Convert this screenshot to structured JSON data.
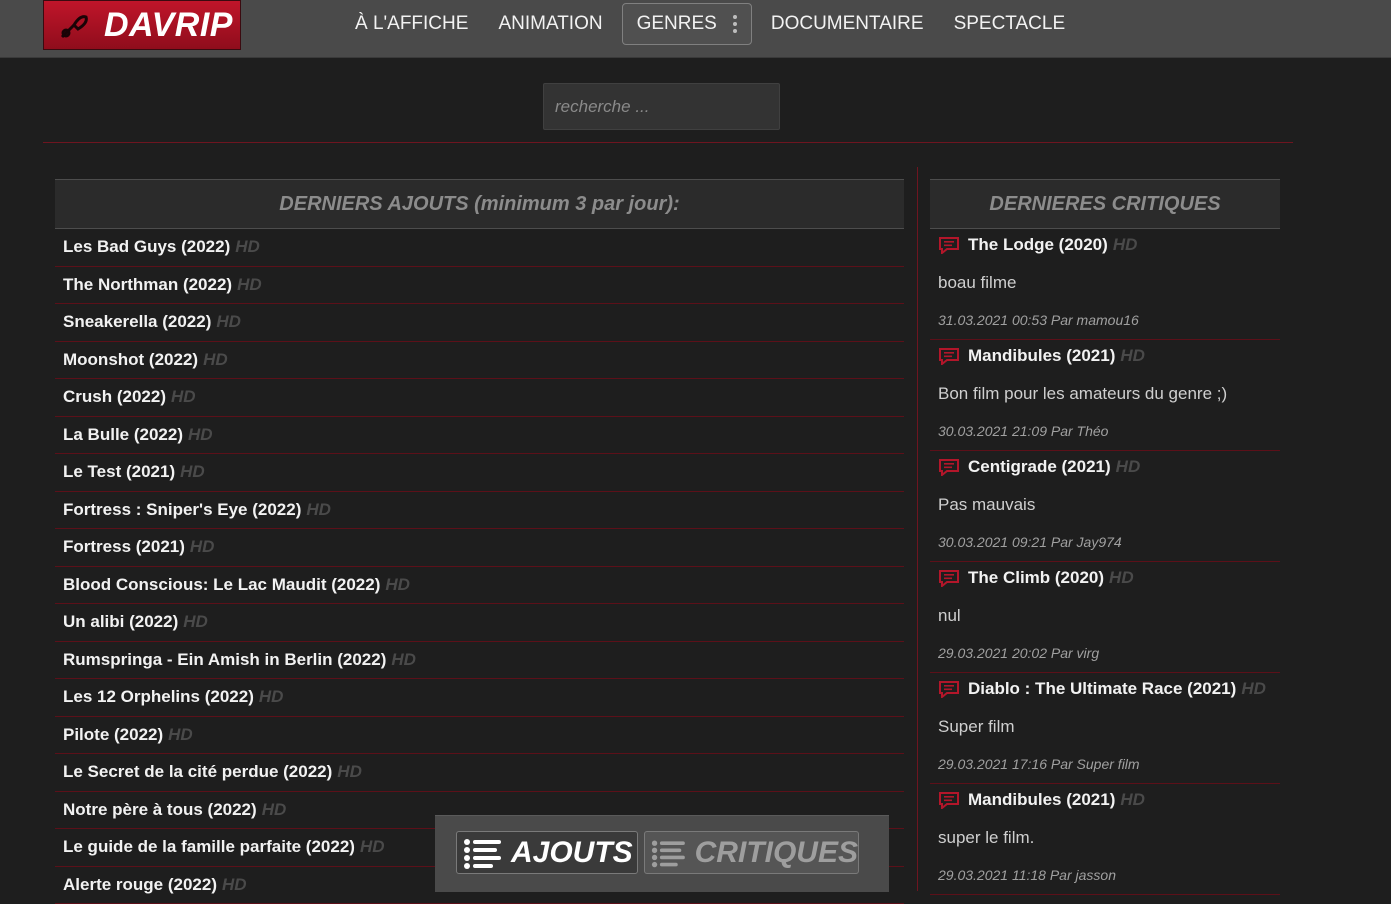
{
  "brand": {
    "name": "DAVRIP"
  },
  "nav": [
    {
      "label": "À L'AFFICHE"
    },
    {
      "label": "ANIMATION"
    },
    {
      "label": "GENRES"
    },
    {
      "label": "DOCUMENTAIRE"
    },
    {
      "label": "SPECTACLE"
    }
  ],
  "search": {
    "placeholder": "recherche ..."
  },
  "latest": {
    "title": "DERNIERS AJOUTS (minimum 3 par jour):",
    "quality": "HD",
    "items": [
      "Les Bad Guys (2022)",
      "The Northman (2022)",
      "Sneakerella (2022)",
      "Moonshot (2022)",
      "Crush (2022)",
      "La Bulle (2022)",
      "Le Test (2021)",
      "Fortress : Sniper's Eye (2022)",
      "Fortress (2021)",
      "Blood Conscious: Le Lac Maudit (2022)",
      "Un alibi (2022)",
      "Rumspringa - Ein Amish in Berlin (2022)",
      "Les 12 Orphelins (2022)",
      "Pilote (2022)",
      "Le Secret de la cité perdue (2022)",
      "Notre père à tous (2022)",
      "Le guide de la famille parfaite (2022)",
      "Alerte rouge (2022)"
    ]
  },
  "reviews": {
    "title": "DERNIERES CRITIQUES",
    "quality": "HD",
    "items": [
      {
        "film": "The Lodge (2020)",
        "text": "boau filme",
        "meta": "31.03.2021 00:53 Par mamou16"
      },
      {
        "film": "Mandibules (2021)",
        "text": "Bon film pour les amateurs du genre ;)",
        "meta": "30.03.2021 21:09 Par Théo"
      },
      {
        "film": "Centigrade (2021)",
        "text": "Pas mauvais",
        "meta": "30.03.2021 09:21 Par Jay974"
      },
      {
        "film": "The Climb (2020)",
        "text": "nul",
        "meta": "29.03.2021 20:02 Par virg"
      },
      {
        "film": "Diablo : The Ultimate Race (2021)",
        "text": "Super film",
        "meta": "29.03.2021 17:16 Par Super film"
      },
      {
        "film": "Mandibules (2021)",
        "text": "super le film.",
        "meta": "29.03.2021 11:18 Par jasson"
      }
    ]
  },
  "tabs": {
    "ajouts": "AJOUTS",
    "critiques": "CRITIQUES"
  },
  "colors": {
    "accent": "#c0152a",
    "line": "#5c1019",
    "background": "#1e1e1e"
  }
}
